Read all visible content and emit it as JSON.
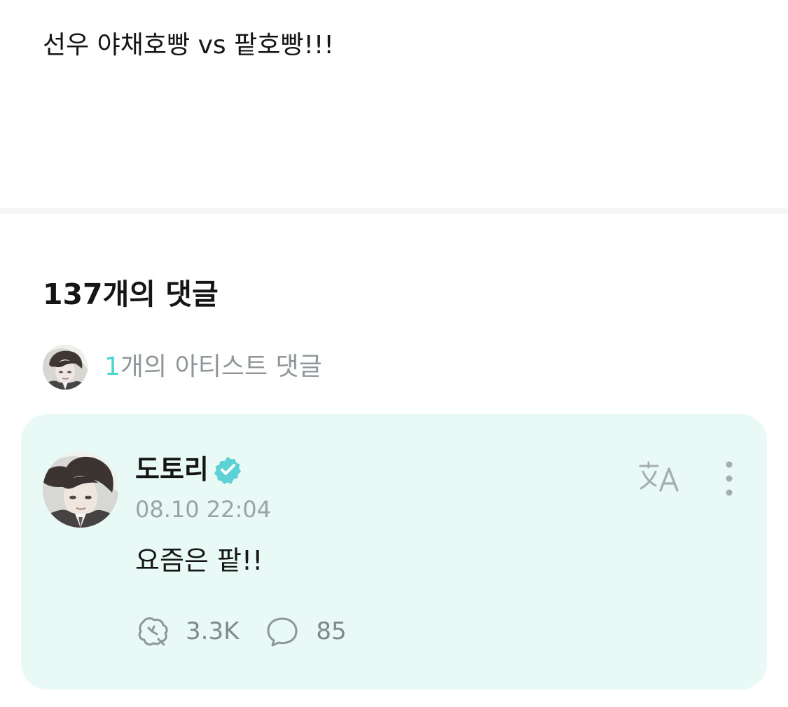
{
  "post": {
    "text": "선우 야채호빵 vs 팥호빵!!!"
  },
  "comments": {
    "count_label": "137개의 댓글",
    "artist_summary": {
      "count": "1",
      "label": "개의 아티스트 댓글",
      "avatar_icon": "artist-avatar"
    }
  },
  "artist_comment": {
    "author": "도토리",
    "verified_icon": "verified-check-icon",
    "timestamp": "08.10 22:04",
    "text": "요즘은 팥!!",
    "translate_icon": "translate-icon",
    "more_icon": "more-vertical-icon",
    "reactions": {
      "like_count": "3.3K",
      "reply_count": "85",
      "like_icon": "reaction-icon",
      "reply_icon": "comment-bubble-icon"
    }
  },
  "colors": {
    "accent": "#4dd3d0",
    "card_background": "#e9f9f6",
    "muted_text": "#9ca3a5"
  }
}
